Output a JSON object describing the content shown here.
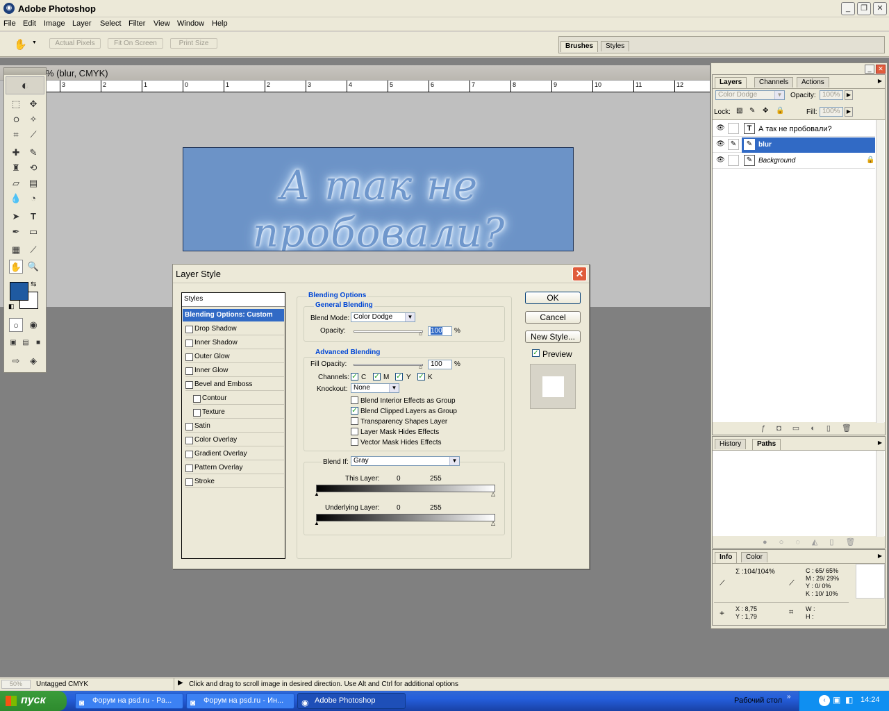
{
  "app": {
    "title": "Adobe Photoshop"
  },
  "menu": [
    "File",
    "Edit",
    "Image",
    "Layer",
    "Select",
    "Filter",
    "View",
    "Window",
    "Help"
  ],
  "options_bar": {
    "buttons": [
      "Actual Pixels",
      "Fit On Screen",
      "Print Size"
    ]
  },
  "palette_well": {
    "tabs": [
      "Brushes",
      "Styles"
    ]
  },
  "document": {
    "title": "% (blur, CMYK)",
    "ruler_labels": [
      "3",
      "2",
      "1",
      "0",
      "1",
      "2",
      "3",
      "4",
      "5",
      "6",
      "7",
      "8",
      "9",
      "10",
      "11",
      "12"
    ],
    "canvas_text": "А так не пробовали?"
  },
  "layers_panel": {
    "tabs": [
      "Layers",
      "Channels",
      "Actions"
    ],
    "blend_mode": "Color Dodge",
    "opacity_label": "Opacity:",
    "opacity_value": "100%",
    "lock_label": "Lock:",
    "fill_label": "Fill:",
    "fill_value": "100%",
    "layers": [
      {
        "name": "А так не пробовали?",
        "selected": false
      },
      {
        "name": "blur",
        "selected": true
      },
      {
        "name": "Background",
        "selected": false
      }
    ]
  },
  "paths_panel": {
    "tabs": [
      "History",
      "Paths"
    ]
  },
  "info_panel": {
    "tabs": [
      "Info",
      "Color"
    ],
    "sigma": "Σ :104/104%",
    "cmyk": [
      "C : 65/ 65%",
      "M : 29/ 29%",
      "Y : 0/ 0%",
      "K : 10/ 10%"
    ],
    "xy": [
      "X : 8,75",
      "Y : 1,79"
    ],
    "wh": [
      "W :",
      "H :"
    ]
  },
  "dialog": {
    "title": "Layer Style",
    "styles_header": "Styles",
    "blending_options_item": "Blending Options: Custom",
    "style_items": [
      "Drop Shadow",
      "Inner Shadow",
      "Outer Glow",
      "Inner Glow",
      "Bevel and Emboss",
      "Contour",
      "Texture",
      "Satin",
      "Color Overlay",
      "Gradient Overlay",
      "Pattern Overlay",
      "Stroke"
    ],
    "blending_options_title": "Blending Options",
    "general_blending": "General Blending",
    "blend_mode_label": "Blend Mode:",
    "blend_mode_value": "Color Dodge",
    "opacity_label": "Opacity:",
    "opacity_value": "100",
    "percent": "%",
    "advanced_blending": "Advanced Blending",
    "fill_opacity_label": "Fill Opacity:",
    "fill_opacity_value": "100",
    "channels_label": "Channels:",
    "channels": [
      "C",
      "M",
      "Y",
      "K"
    ],
    "knockout_label": "Knockout:",
    "knockout_value": "None",
    "adv_checks": [
      {
        "label": "Blend Interior Effects as Group",
        "checked": false
      },
      {
        "label": "Blend Clipped Layers as Group",
        "checked": true
      },
      {
        "label": "Transparency Shapes Layer",
        "checked": false
      },
      {
        "label": "Layer Mask Hides Effects",
        "checked": false
      },
      {
        "label": "Vector Mask Hides Effects",
        "checked": false
      }
    ],
    "blend_if_label": "Blend If:",
    "blend_if_value": "Gray",
    "this_layer_label": "This Layer:",
    "underlying_layer_label": "Underlying Layer:",
    "range_low": "0",
    "range_high": "255",
    "ok": "OK",
    "cancel": "Cancel",
    "new_style": "New Style...",
    "preview": "Preview"
  },
  "status": {
    "zoom": "50%",
    "profile": "Untagged CMYK",
    "hint": "Click and drag to scroll image in desired direction.  Use Alt and Ctrl for additional options"
  },
  "taskbar": {
    "start": "пуск",
    "tasks": [
      "Форум на psd.ru - Ра...",
      "Форум на psd.ru - Ин...",
      "Adobe Photoshop"
    ],
    "desktop_label": "Рабочий стол",
    "lang": "EN",
    "time": "14:24"
  },
  "colors": {
    "foreground": "#1f5aa1",
    "background": "#ffffff",
    "canvas_bg": "#6c93c7",
    "selection": "#316ac5"
  }
}
